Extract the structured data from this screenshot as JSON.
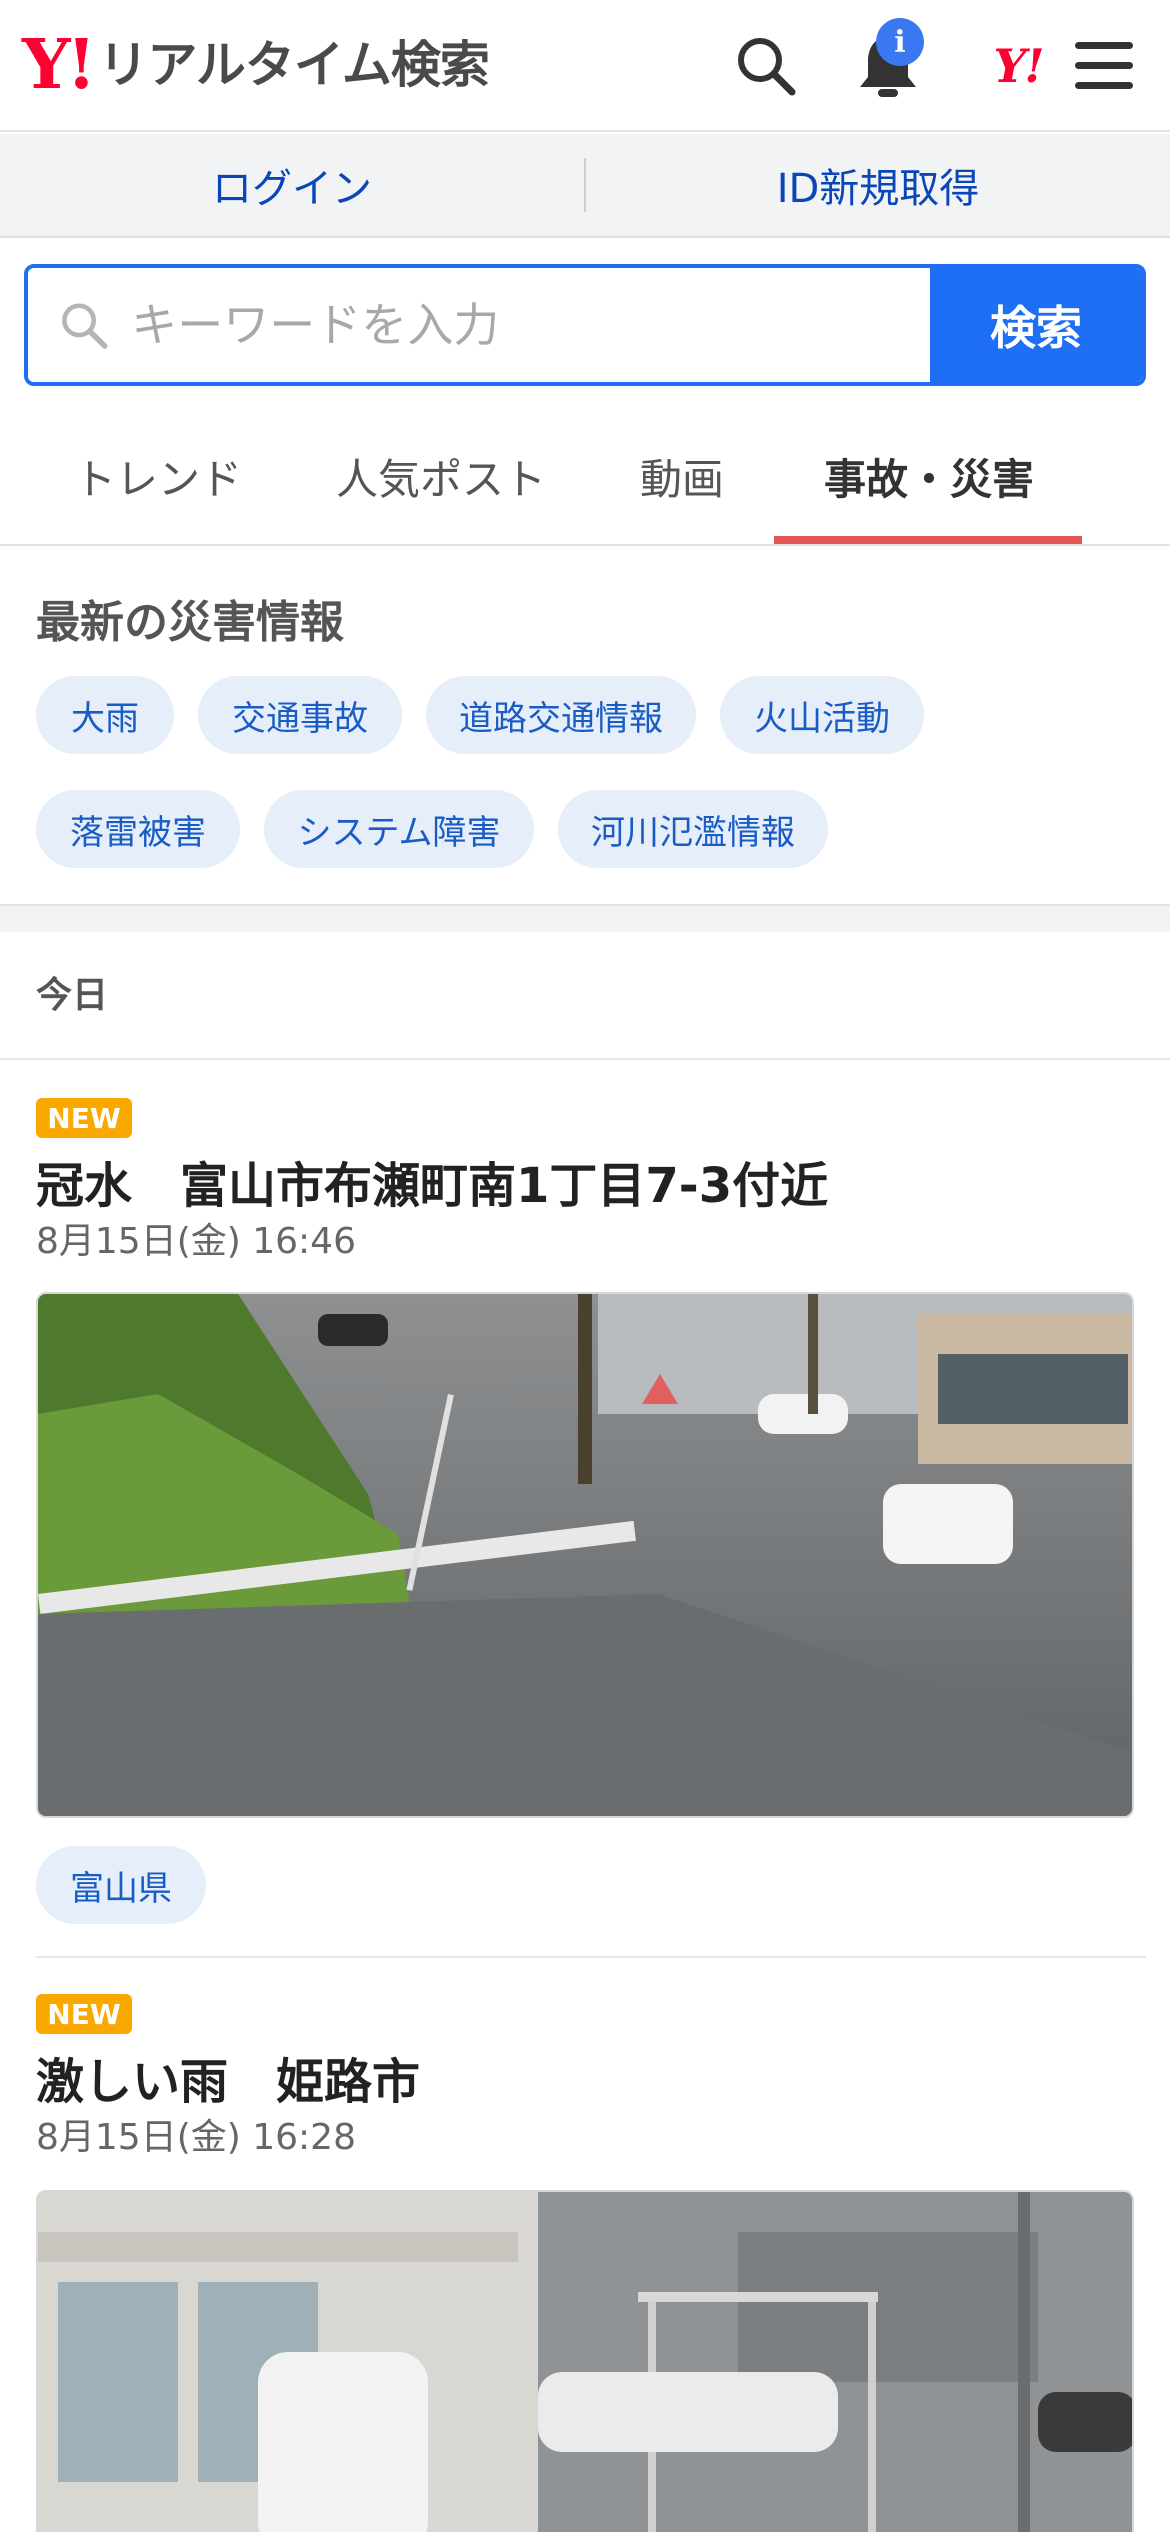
{
  "header": {
    "logo_mark": "Y!",
    "logo_text": "リアルタイム検索",
    "notification_badge": "i",
    "yj_mark": "Y!"
  },
  "account": {
    "login": "ログイン",
    "register": "ID新規取得"
  },
  "search": {
    "placeholder": "キーワードを入力",
    "button": "検索"
  },
  "tabs": [
    {
      "label": "トレンド",
      "active": false
    },
    {
      "label": "人気ポスト",
      "active": false
    },
    {
      "label": "動画",
      "active": false
    },
    {
      "label": "事故・災害",
      "active": true
    }
  ],
  "disaster": {
    "title": "最新の災害情報",
    "chips": [
      "大雨",
      "交通事故",
      "道路交通情報",
      "火山活動",
      "落雷被害",
      "システム障害",
      "河川氾濫情報"
    ]
  },
  "feed": {
    "day_label": "今日",
    "posts": [
      {
        "badge": "NEW",
        "title": "冠水　富山市布瀬町南1丁目7-3付近",
        "date": "8月15日(金) 16:46",
        "location": "富山県"
      },
      {
        "badge": "NEW",
        "title": "激しい雨　姫路市",
        "date": "8月15日(金) 16:28"
      }
    ]
  },
  "colors": {
    "brand_red": "#ff0033",
    "accent_blue": "#1f6ff5",
    "tab_underline": "#e55454",
    "new_badge": "#f9a800"
  }
}
